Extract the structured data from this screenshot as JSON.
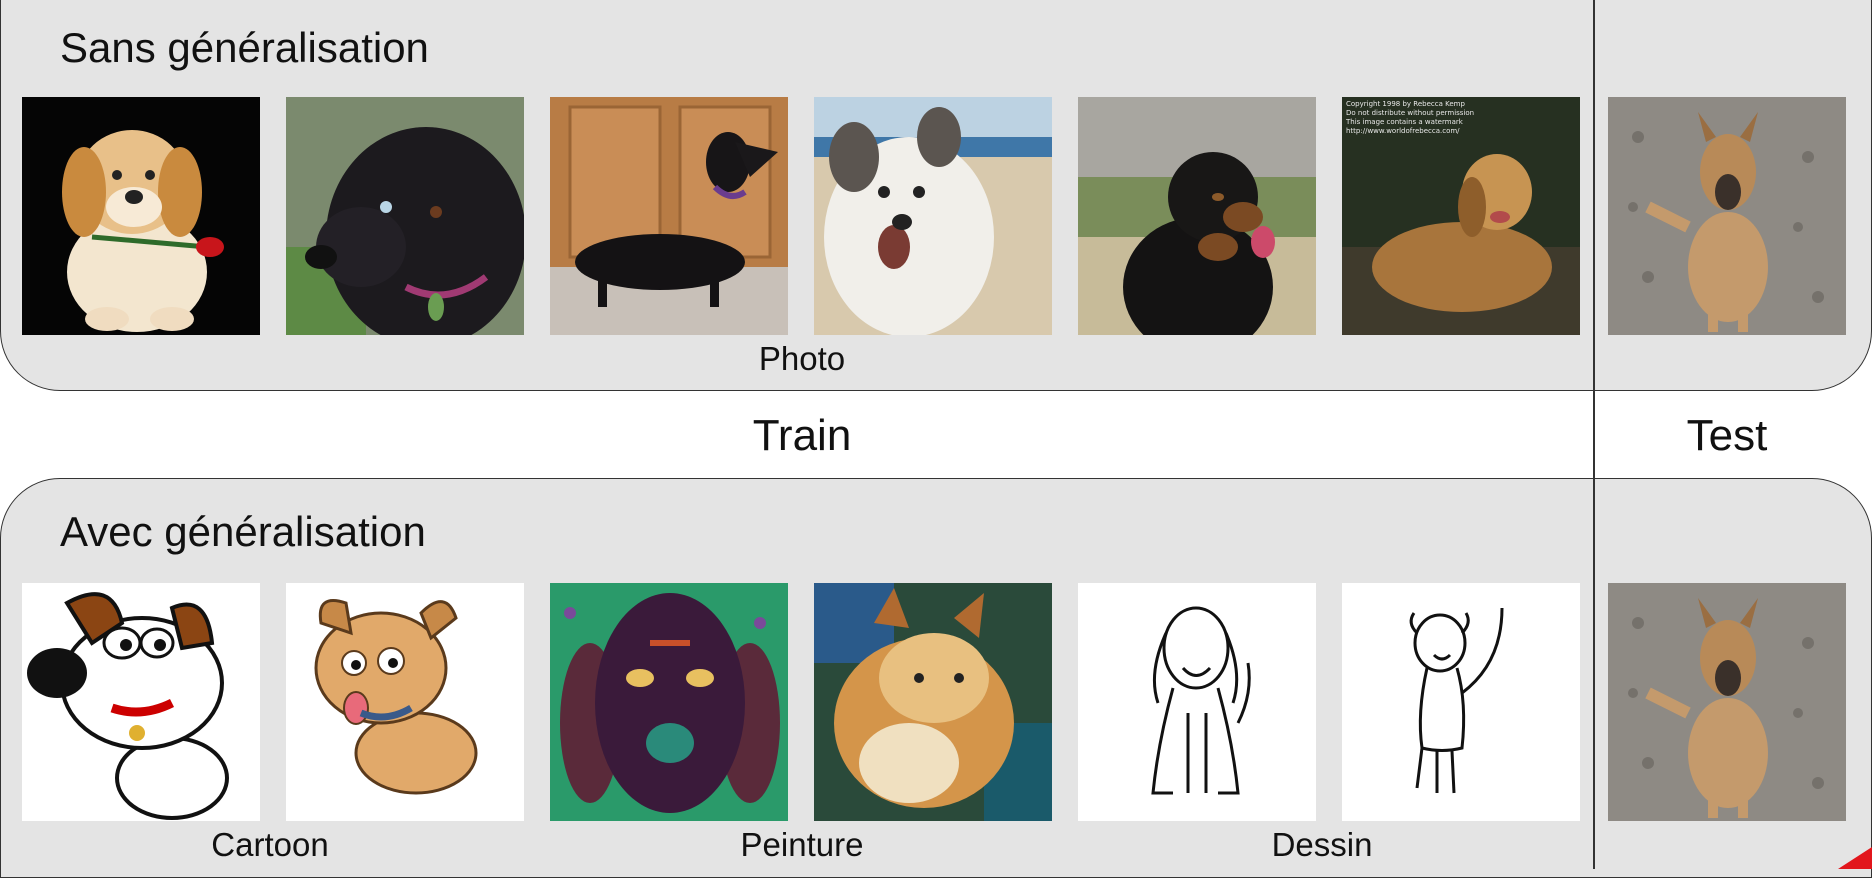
{
  "top_section": {
    "title": "Sans généralisation",
    "caption": "Photo"
  },
  "middle": {
    "train_label": "Train",
    "test_label": "Test"
  },
  "bottom_section": {
    "title": "Avec généralisation",
    "captions": [
      "Cartoon",
      "Peinture",
      "Dessin"
    ]
  },
  "photo_watermark": [
    "Copyright 1998 by Rebecca Kemp",
    "Do not distribute without permission",
    "This image contains a watermark",
    "http://www.worldofrebecca.com/"
  ],
  "colors": {
    "panel": "#e4e4e4",
    "border": "#333333",
    "accent_corner": "#e2161c"
  }
}
